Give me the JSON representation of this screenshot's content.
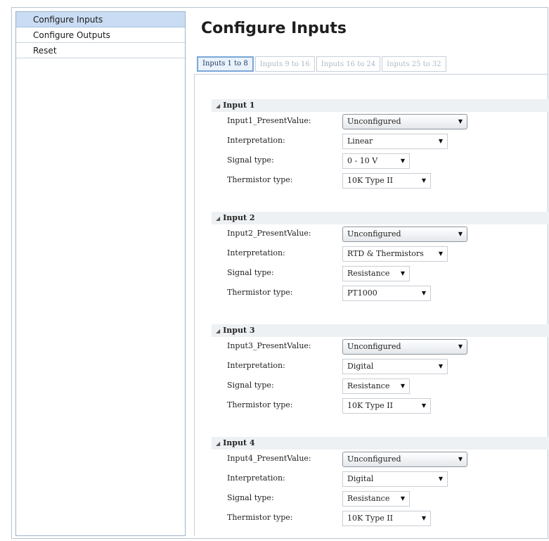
{
  "sidebar": {
    "items": [
      {
        "label": "Configure Inputs",
        "active": true
      },
      {
        "label": "Configure Outputs",
        "active": false
      },
      {
        "label": "Reset",
        "active": false
      }
    ]
  },
  "main": {
    "title": "Configure Inputs",
    "tabs": [
      {
        "label": "Inputs 1 to 8",
        "active": true
      },
      {
        "label": "Inputs 9 to 16",
        "active": false
      },
      {
        "label": "Inputs 16 to 24",
        "active": false
      },
      {
        "label": "Inputs 25 to 32",
        "active": false
      }
    ],
    "groups": [
      {
        "header": "Input 1",
        "present_label": "Input1_PresentValue:",
        "present_value": "Unconfigured",
        "interp_label": "Interpretation:",
        "interp_value": "Linear",
        "signal_label": "Signal type:",
        "signal_value": "0 - 10 V",
        "therm_label": "Thermistor type:",
        "therm_value": "10K Type II"
      },
      {
        "header": "Input 2",
        "present_label": "Input2_PresentValue:",
        "present_value": "Unconfigured",
        "interp_label": "Interpretation:",
        "interp_value": "RTD & Thermistors",
        "signal_label": "Signal type:",
        "signal_value": "Resistance",
        "therm_label": "Thermistor type:",
        "therm_value": "PT1000"
      },
      {
        "header": "Input 3",
        "present_label": "Input3_PresentValue:",
        "present_value": "Unconfigured",
        "interp_label": "Interpretation:",
        "interp_value": "Digital",
        "signal_label": "Signal type:",
        "signal_value": "Resistance",
        "therm_label": "Thermistor type:",
        "therm_value": "10K Type II"
      },
      {
        "header": "Input 4",
        "present_label": "Input4_PresentValue:",
        "present_value": "Unconfigured",
        "interp_label": "Interpretation:",
        "interp_value": "Digital",
        "signal_label": "Signal type:",
        "signal_value": "Resistance",
        "therm_label": "Thermistor type:",
        "therm_value": "10K Type II"
      }
    ]
  },
  "icons": {
    "collapse": "collapse-triangle-icon",
    "dropdown": "chevron-down-icon"
  },
  "colors": {
    "sidebar_active": "#c9dcf3",
    "tab_active_border": "#7aa6d6",
    "group_header_bg": "#eef1f4"
  }
}
